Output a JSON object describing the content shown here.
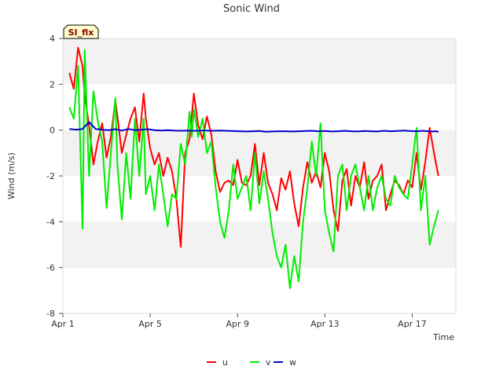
{
  "chart_data": {
    "type": "line",
    "title": "Sonic Wind",
    "badge": "SI_flx",
    "xlabel": "Time",
    "ylabel": "Wind (m/s)",
    "ylim": [
      -8,
      4
    ],
    "yticks": [
      -8,
      -6,
      -4,
      -2,
      0,
      2,
      4
    ],
    "xlim": [
      "2019-04-01",
      "2019-04-19"
    ],
    "xticks": [
      {
        "label": "Apr 1",
        "day": 1
      },
      {
        "label": "Apr 5",
        "day": 5
      },
      {
        "label": "Apr 9",
        "day": 9
      },
      {
        "label": "Apr 13",
        "day": 13
      },
      {
        "label": "Apr 17",
        "day": 17
      }
    ],
    "grid": "horizontal bands",
    "legend": "bottom-center",
    "series": [
      {
        "name": "u",
        "color": "#ff0000",
        "x": [
          1.3,
          1.5,
          1.7,
          1.9,
          2.0,
          2.2,
          2.4,
          2.6,
          2.8,
          3.0,
          3.2,
          3.4,
          3.5,
          3.7,
          3.9,
          4.1,
          4.3,
          4.5,
          4.7,
          4.8,
          5.0,
          5.2,
          5.4,
          5.6,
          5.8,
          6.0,
          6.2,
          6.4,
          6.6,
          6.8,
          6.9,
          7.0,
          7.2,
          7.4,
          7.6,
          7.8,
          8.0,
          8.2,
          8.4,
          8.6,
          8.8,
          9.0,
          9.2,
          9.4,
          9.6,
          9.8,
          10.0,
          10.2,
          10.4,
          10.6,
          10.8,
          11.0,
          11.2,
          11.4,
          11.6,
          11.8,
          12.0,
          12.2,
          12.4,
          12.6,
          12.8,
          13.0,
          13.2,
          13.4,
          13.6,
          13.8,
          14.0,
          14.2,
          14.4,
          14.6,
          14.8,
          15.0,
          15.2,
          15.4,
          15.6,
          15.8,
          16.0,
          16.2,
          16.4,
          16.6,
          16.8,
          17.0,
          17.2,
          17.4,
          17.6,
          17.8,
          18.0,
          18.2
        ],
        "y": [
          2.5,
          1.8,
          3.6,
          2.8,
          1.5,
          0.2,
          -1.5,
          -0.5,
          0.3,
          -1.2,
          -0.3,
          1.3,
          0.6,
          -1.0,
          -0.2,
          0.5,
          1.0,
          -0.5,
          1.6,
          0.5,
          -0.8,
          -1.5,
          -1.0,
          -2.0,
          -1.2,
          -1.8,
          -3.0,
          -5.1,
          -1.0,
          -0.4,
          0.6,
          1.6,
          0.2,
          -0.4,
          0.6,
          -0.2,
          -1.8,
          -2.7,
          -2.3,
          -2.2,
          -2.4,
          -1.3,
          -2.3,
          -2.4,
          -2.0,
          -0.6,
          -2.4,
          -1.0,
          -2.3,
          -2.8,
          -3.5,
          -2.1,
          -2.6,
          -1.8,
          -3.2,
          -4.2,
          -2.5,
          -1.4,
          -2.3,
          -1.8,
          -2.5,
          -1.0,
          -1.8,
          -3.5,
          -4.4,
          -2.2,
          -1.7,
          -3.3,
          -2.0,
          -2.5,
          -1.4,
          -3.0,
          -2.2,
          -2.0,
          -1.5,
          -3.5,
          -2.8,
          -2.2,
          -2.4,
          -2.8,
          -2.2,
          -2.5,
          -1.0,
          -2.6,
          -1.4,
          0.1,
          -1.0,
          -2.0
        ]
      },
      {
        "name": "v",
        "color": "#00ee00",
        "x": [
          1.3,
          1.5,
          1.7,
          1.9,
          2.0,
          2.2,
          2.4,
          2.6,
          2.8,
          3.0,
          3.2,
          3.4,
          3.5,
          3.7,
          3.9,
          4.1,
          4.3,
          4.5,
          4.7,
          4.8,
          5.0,
          5.2,
          5.4,
          5.6,
          5.8,
          6.0,
          6.2,
          6.4,
          6.6,
          6.8,
          6.9,
          7.0,
          7.2,
          7.4,
          7.6,
          7.8,
          8.0,
          8.2,
          8.4,
          8.6,
          8.8,
          9.0,
          9.2,
          9.4,
          9.6,
          9.8,
          10.0,
          10.2,
          10.4,
          10.6,
          10.8,
          11.0,
          11.2,
          11.4,
          11.6,
          11.8,
          12.0,
          12.2,
          12.4,
          12.6,
          12.8,
          13.0,
          13.2,
          13.4,
          13.6,
          13.8,
          14.0,
          14.2,
          14.4,
          14.6,
          14.8,
          15.0,
          15.2,
          15.4,
          15.6,
          15.8,
          16.0,
          16.2,
          16.4,
          16.6,
          16.8,
          17.0,
          17.2,
          17.4,
          17.6,
          17.8,
          18.0,
          18.2
        ],
        "y": [
          1.0,
          0.5,
          2.8,
          -4.3,
          3.5,
          -2.0,
          1.7,
          0.4,
          -0.5,
          -3.4,
          -1.0,
          1.4,
          -1.5,
          -3.9,
          -1.0,
          -3.0,
          0.5,
          -2.0,
          0.5,
          -2.8,
          -2.0,
          -3.5,
          -1.5,
          -2.8,
          -4.2,
          -2.8,
          -3.0,
          -0.6,
          -1.5,
          0.8,
          -0.3,
          0.9,
          -0.3,
          0.5,
          -1.0,
          -0.5,
          -2.5,
          -4.0,
          -4.7,
          -3.5,
          -1.5,
          -3.0,
          -2.5,
          -2.0,
          -3.5,
          -1.0,
          -3.2,
          -1.8,
          -3.0,
          -4.5,
          -5.5,
          -6.0,
          -5.0,
          -6.9,
          -5.5,
          -6.6,
          -4.0,
          -2.5,
          -0.5,
          -2.0,
          0.3,
          -3.5,
          -4.5,
          -5.3,
          -2.0,
          -1.5,
          -3.5,
          -2.0,
          -1.5,
          -2.5,
          -3.5,
          -2.0,
          -3.5,
          -2.5,
          -2.0,
          -3.0,
          -3.3,
          -2.0,
          -2.5,
          -2.8,
          -3.0,
          -1.5,
          0.1,
          -3.5,
          -2.0,
          -5.0,
          -4.2,
          -3.5
        ]
      },
      {
        "name": "w",
        "color": "#0000cc",
        "x": [
          1.3,
          1.6,
          1.9,
          2.2,
          2.5,
          2.8,
          3.1,
          3.4,
          3.7,
          4.0,
          4.3,
          4.6,
          4.9,
          5.2,
          5.5,
          5.8,
          6.1,
          6.4,
          6.7,
          7.0,
          7.3,
          7.6,
          7.9,
          8.2,
          8.5,
          8.8,
          9.1,
          9.4,
          9.7,
          10.0,
          10.3,
          10.6,
          10.9,
          11.2,
          11.5,
          11.8,
          12.1,
          12.4,
          12.7,
          13.0,
          13.3,
          13.6,
          13.9,
          14.2,
          14.5,
          14.8,
          15.1,
          15.4,
          15.7,
          16.0,
          16.3,
          16.6,
          16.9,
          17.2,
          17.5,
          17.8,
          18.1,
          18.2
        ],
        "y": [
          0.05,
          0.02,
          0.05,
          0.35,
          0.05,
          0.02,
          0.0,
          0.04,
          -0.02,
          0.05,
          0.0,
          0.02,
          0.04,
          0.0,
          -0.02,
          0.0,
          -0.02,
          -0.03,
          -0.02,
          -0.03,
          -0.02,
          -0.02,
          -0.03,
          -0.02,
          -0.03,
          -0.04,
          -0.05,
          -0.06,
          -0.05,
          -0.04,
          -0.07,
          -0.06,
          -0.05,
          -0.05,
          -0.06,
          -0.05,
          -0.04,
          -0.03,
          -0.05,
          -0.04,
          -0.06,
          -0.05,
          -0.03,
          -0.05,
          -0.06,
          -0.04,
          -0.05,
          -0.06,
          -0.03,
          -0.05,
          -0.04,
          -0.02,
          -0.04,
          -0.05,
          -0.03,
          -0.06,
          -0.05,
          -0.08
        ]
      }
    ]
  }
}
